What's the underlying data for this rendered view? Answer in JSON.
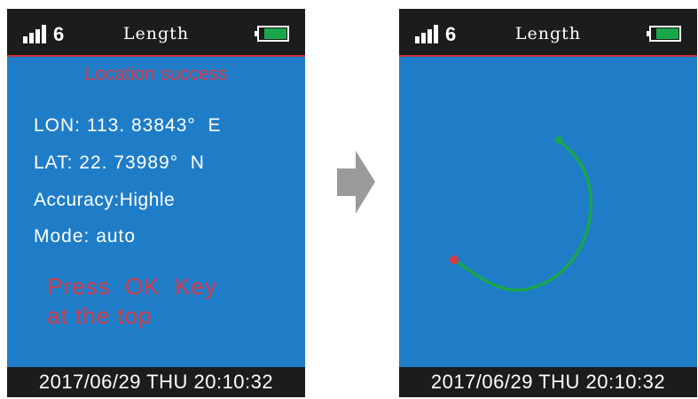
{
  "colors": {
    "screen_background": "#1f7dc8",
    "bar_background": "#1c1c1c",
    "accent_red": "#d53a46",
    "track_green": "#1aa64a",
    "battery_green": "#1aa64a"
  },
  "screens": [
    {
      "status_bar": {
        "signal_count": "6",
        "title": "Length",
        "battery_icon": "battery-full-icon"
      },
      "location_status": "Location success",
      "lon": "LON: 113. 83843°  E",
      "lat": "LAT: 22. 73989°  N",
      "accuracy": "Accuracy:Highle",
      "mode": "Mode: auto",
      "prompt_line_1": "Press  OK  Key",
      "prompt_line_2": "at the top",
      "footer": "2017/06/29  THU  20:10:32"
    },
    {
      "status_bar": {
        "signal_count": "6",
        "title": "Length",
        "battery_icon": "battery-full-icon"
      },
      "track": {
        "start_marker": "red-dot",
        "end_marker": "green-dot",
        "line_color": "#1aa64a"
      },
      "footer": "2017/06/29  THU  20:10:32"
    }
  ],
  "transition_icon": "arrow-right-icon"
}
